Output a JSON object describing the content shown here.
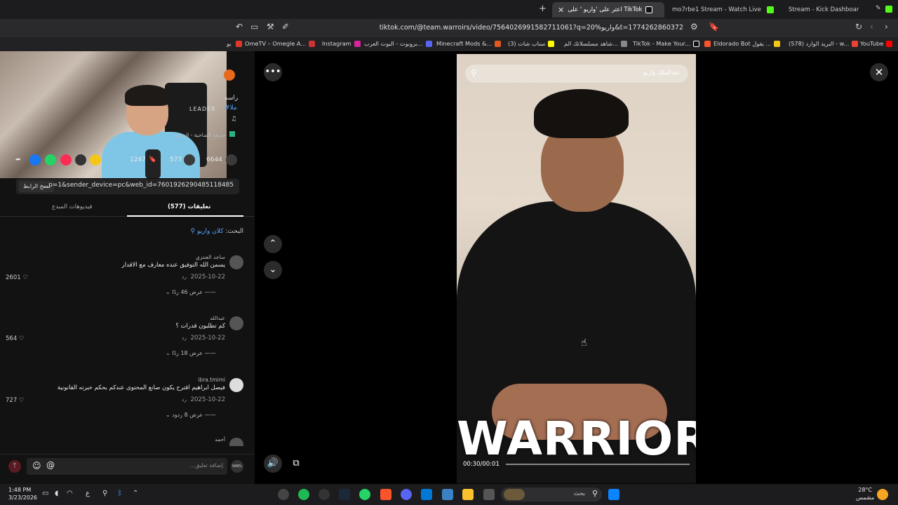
{
  "browser": {
    "tabs": [
      {
        "label": "اعثر على 'واريو ' على TikTok",
        "active": true
      },
      {
        "label": "mo7rbe1 Stream - Watch Live on Kick",
        "active": false
      },
      {
        "label": "Stream - Kick Dashboard",
        "active": false
      }
    ],
    "url": "tiktok.com/@team.warroirs/video/7564026991582711061?q=20%واريو&t=1774262860372",
    "bookmarks": [
      "يو",
      "OmeTV – Omegle A...",
      "Instagram",
      "بروبوت - البوت العرب...",
      "Minecraft Mods &...",
      "(3) سناب شات",
      "شاهد مسلسلاتك الم...",
      "TikTok - Make Your...",
      "Eldorado Bot يقول ...",
      "(578) البريد الوارد - w...",
      "YouTube"
    ]
  },
  "webcam": {
    "overlay_text": "LEADER"
  },
  "post": {
    "caption_fragment": "راسه",
    "hashtag": "#ملا",
    "music_note": "♫",
    "location": "حديقة الضاحية - الدمام"
  },
  "actions": {
    "likes": "6644",
    "comments": "577",
    "saves": "1247"
  },
  "link": {
    "copy_label": "نسخ الرابط",
    "url_fragment": "...p=1&sender_device=pc&web_id=7601926290485118485"
  },
  "panel_tabs": {
    "comments": "(577) تعليقات",
    "creator_videos": "فيديوهات المبدع"
  },
  "search_keyword": {
    "prefix": "البحث:",
    "keyword": "كلان واريو"
  },
  "comments": [
    {
      "user": "ساجد العنتزي",
      "text": "يسمن الله التوفيق عنده معارف مع الاقدار",
      "date": "2025-10-22",
      "reply": "رد",
      "likes": "2601",
      "view_replies": "عرض 46 ردًا"
    },
    {
      "user": "عبدالله",
      "text": "كم تطلبون قدرات ؟",
      "date": "2025-10-22",
      "reply": "رد",
      "likes": "564",
      "view_replies": "عرض 18 ردًا"
    },
    {
      "user": "ibra.tmimi",
      "text": "فيصل ابراهيم اقترح يكون صانع المحتوى عندكم بحكم خبرته القانونية",
      "date": "2025-10-22",
      "reply": "رد",
      "likes": "727",
      "view_replies": "عرض 8 ردود"
    },
    {
      "user": "أحمد",
      "text": "",
      "date": "",
      "reply": "",
      "likes": "",
      "view_replies": ""
    }
  ],
  "comment_input": {
    "placeholder": "إضافة تعليق..."
  },
  "video": {
    "search_text": "عبدالملك واريو",
    "overlay_title": "WARRIOR",
    "time": "00:30/00:01"
  },
  "taskbar": {
    "time": "1:48 PM",
    "date": "3/23/2026",
    "search_label": "بحث",
    "temperature": "28°C",
    "weather": "مشمس",
    "lang": "ع"
  },
  "colors": {
    "accent": "#fe2c55",
    "link": "#5aa4ff"
  }
}
